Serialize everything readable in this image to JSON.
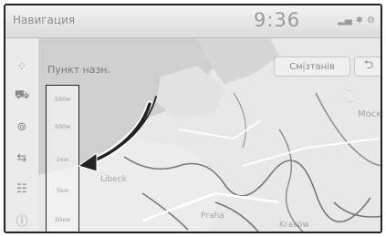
{
  "status_bar": {
    "title": "Навигация",
    "clock": "9:36",
    "icons": [
      "signal-icon",
      "bluetooth-icon",
      "settings-icon"
    ]
  },
  "menu": {
    "point_search_label": "Пункт назн.",
    "left_items": [
      "apps-icon",
      "car-icon",
      "search-icon",
      "route-icon",
      "list-icon",
      "info-icon"
    ]
  },
  "buttons": {
    "settings": "Смі̦зтанів",
    "back": "⮌"
  },
  "scale_options": [
    "500м",
    "500м",
    "2км",
    "5км",
    "20км"
  ],
  "side_info": {
    "line1": "···",
    "line2": "···",
    "region": "Моско"
  },
  "map_labels": [
    {
      "text": "Libeck"
    },
    {
      "text": "Praha"
    },
    {
      "text": "Kraków"
    }
  ],
  "colors": {
    "map_bg": "#e8e8e8",
    "water": "#cfcfcf",
    "border": "#7a7a7a",
    "road": "#ffffff",
    "arrow": "#222222"
  }
}
